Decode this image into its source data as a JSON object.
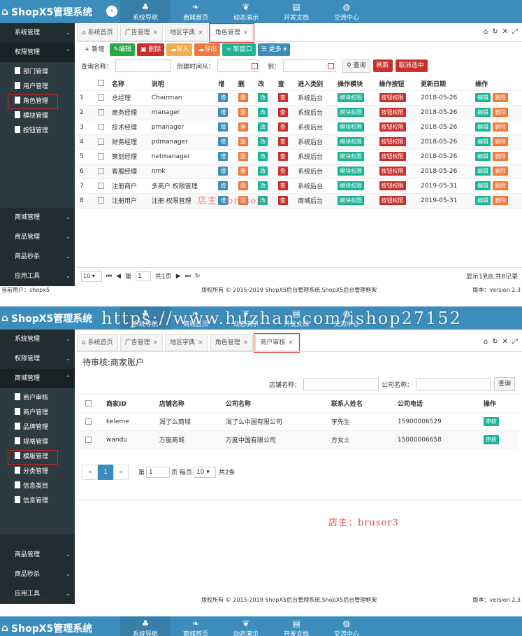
{
  "app": {
    "title": "ShopX5管理系统"
  },
  "nav": {
    "items": [
      "系统导航",
      "商城首页",
      "动态演示",
      "开发文档",
      "交流中心"
    ]
  },
  "tools": {
    "home": "⌂",
    "refresh": "↻",
    "close": "✕",
    "fullscreen": "⤢"
  },
  "s1": {
    "sidebar": {
      "groups": [
        "系统管理",
        "权限管理",
        "商城管理",
        "商品管理",
        "商品秒杀",
        "应用工具"
      ],
      "sub": [
        "部门管理",
        "用户管理",
        "角色管理",
        "模块管理",
        "按钮管理"
      ]
    },
    "tabs": [
      "系统首页",
      "广告管理",
      "地区字典",
      "角色管理"
    ],
    "toolbar": {
      "add": "新增",
      "edit": "编辑",
      "delete": "删除",
      "import": "导入",
      "export": "导出",
      "newwin": "新窗口",
      "more": "更多"
    },
    "search": {
      "name_label": "查询名称：",
      "date_label": "创建时间从：",
      "to_label": "到：",
      "query": "查询",
      "refresh": "刷新",
      "unselect": "取消选中"
    },
    "columns": [
      "名称",
      "说明",
      "增",
      "删",
      "改",
      "查",
      "进入类别",
      "操作模块",
      "操作按钮",
      "更新日期",
      "操作"
    ],
    "rows": [
      {
        "no": "1",
        "name": "总经理",
        "desc": "Chairman",
        "cat": "系统后台",
        "date": "2018-05-26"
      },
      {
        "no": "2",
        "name": "商务经理",
        "desc": "manager",
        "cat": "系统后台",
        "date": "2018-05-26"
      },
      {
        "no": "3",
        "name": "技术经理",
        "desc": "pmanager",
        "cat": "系统后台",
        "date": "2018-05-26"
      },
      {
        "no": "4",
        "name": "财务经理",
        "desc": "pdmanager",
        "cat": "系统后台",
        "date": "2018-05-26"
      },
      {
        "no": "5",
        "name": "策划经理",
        "desc": "netmanager",
        "cat": "系统后台",
        "date": "2018-05-26"
      },
      {
        "no": "6",
        "name": "客服经理",
        "desc": "nmk",
        "cat": "系统后台",
        "date": "2018-05-26"
      },
      {
        "no": "7",
        "name": "注册商户",
        "desc": "多商户 权限管理",
        "cat": "系统后台",
        "date": "2019-05-31"
      },
      {
        "no": "8",
        "name": "注册用户",
        "desc": "注册 权限管理",
        "cat": "商城后台",
        "date": "2019-05-31"
      }
    ],
    "row_btns": {
      "add": "增",
      "del": "删",
      "mod": "改",
      "view": "查",
      "module": "模块权限",
      "button": "按钮权限",
      "edit": "编辑",
      "delete": "删除"
    },
    "pager": {
      "size": "10",
      "page_prefix": "第",
      "page": "1",
      "page_suffix": "共1页",
      "summary": "显示1到8,共8记录"
    }
  },
  "footer": {
    "user": "当前用户：shopx5",
    "copyright": "版权所有 © 2015-2019 ShopX5后台管理系统,ShopX5后台管理框架",
    "version": "版本：version 2.3"
  },
  "watermark": "https://www.huzhan.com/ishop27152",
  "stamp1": "店主：bruser3",
  "stamp2": "店主：bruser3",
  "s2": {
    "sidebar": {
      "groups_top": [
        "系统管理",
        "权限管理",
        "商城管理"
      ],
      "sub": [
        "商户审核",
        "商户管理",
        "品牌管理",
        "规格管理",
        "模版管理",
        "分类管理",
        "信息类目",
        "信息管理"
      ],
      "groups_bottom": [
        "商品管理",
        "商品秒杀",
        "应用工具"
      ]
    },
    "tabs": [
      "系统首页",
      "广告管理",
      "地区字典",
      "角色管理",
      "商户审核"
    ],
    "title": "待审核:商家账户",
    "search": {
      "shop_label": "店铺名称：",
      "company_label": "公司名称：",
      "query": "查询"
    },
    "columns": [
      "商家ID",
      "店铺名称",
      "公司名称",
      "联系人姓名",
      "公司电话",
      "操作"
    ],
    "rows": [
      {
        "id": "keleme",
        "shop": "渴了么商城",
        "company": "渴了么中国有限公司",
        "contact": "李先生",
        "phone": "15900006529"
      },
      {
        "id": "wandu",
        "shop": "万度商城",
        "company": "万度中国有限公司",
        "contact": "方女士",
        "phone": "15000006658"
      }
    ],
    "audit": "审核",
    "pager": {
      "prev": "«",
      "cur": "1",
      "next": "»",
      "page_prefix": "第",
      "page": "1",
      "per_page": "页 每页",
      "size": "10",
      "total": "共2条"
    }
  }
}
